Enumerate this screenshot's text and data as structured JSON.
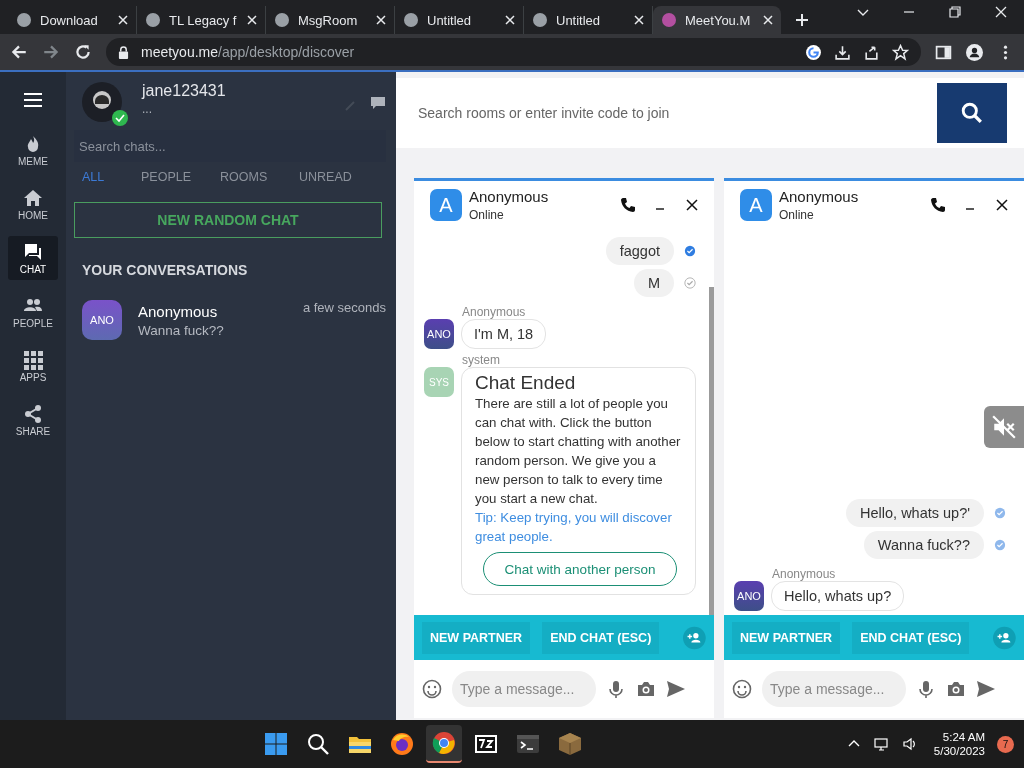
{
  "browser": {
    "tabs": [
      {
        "title": "Download",
        "selected": false
      },
      {
        "title": "TL Legacy f",
        "selected": false
      },
      {
        "title": "MsgRoom",
        "selected": false
      },
      {
        "title": "Untitled",
        "selected": false
      },
      {
        "title": "Untitled",
        "selected": false
      },
      {
        "title": "MeetYou.M",
        "selected": true
      }
    ],
    "address": {
      "domain": "meetyou.me",
      "path": "/app/desktop/discover"
    }
  },
  "nav": [
    {
      "label": "MEME",
      "selected": false
    },
    {
      "label": "HOME",
      "selected": false
    },
    {
      "label": "CHAT",
      "selected": true
    },
    {
      "label": "PEOPLE",
      "selected": false
    },
    {
      "label": "APPS",
      "selected": false
    },
    {
      "label": "SHARE",
      "selected": false
    }
  ],
  "profile": {
    "username": "jane123431",
    "status": "...",
    "online": true
  },
  "chat_search": {
    "placeholder": "Search chats..."
  },
  "filters": [
    {
      "label": "ALL",
      "selected": true
    },
    {
      "label": "PEOPLE",
      "selected": false
    },
    {
      "label": "ROOMS",
      "selected": false
    },
    {
      "label": "UNREAD",
      "selected": false
    }
  ],
  "new_chat_button": "NEW RANDOM CHAT",
  "conversations_heading": "YOUR CONVERSATIONS",
  "conversations": [
    {
      "avatar": "ANO",
      "name": "Anonymous",
      "preview": "Wanna fuck??",
      "time": "a few seconds"
    }
  ],
  "room_search": {
    "placeholder": "Search rooms or enter invite code to join"
  },
  "chat_windows": [
    {
      "avatar": "A",
      "name": "Anonymous",
      "status": "Online",
      "sound_muted": false,
      "messages": [
        {
          "kind": "sent",
          "text": "faggot",
          "read": true
        },
        {
          "kind": "sent",
          "text": "M",
          "read": false
        },
        {
          "kind": "received",
          "sender": "Anonymous",
          "avatar": "ANO",
          "text": "I'm M, 18"
        },
        {
          "kind": "system",
          "sender": "system",
          "avatar": "SYS",
          "title": "Chat Ended",
          "body": "There are still a lot of people you can chat with. Click the button below to start chatting with another random person. We give you a new person to talk to every time you start a new chat.",
          "tip": "Tip: Keep trying, you will discover great people.",
          "button": "Chat with another person"
        }
      ],
      "actions": [
        "NEW PARTNER",
        "END CHAT (ESC)"
      ],
      "input": {
        "placeholder": "Type a message..."
      }
    },
    {
      "avatar": "A",
      "name": "Anonymous",
      "status": "Online",
      "sound_muted": true,
      "messages": [
        {
          "kind": "sent",
          "text": "Hello, whats up?'",
          "read": true
        },
        {
          "kind": "sent",
          "text": "Wanna fuck??",
          "read": true
        },
        {
          "kind": "received",
          "sender": "Anonymous",
          "avatar": "ANO",
          "text": "Hello, whats up?"
        }
      ],
      "actions": [
        "NEW PARTNER",
        "END CHAT (ESC)"
      ],
      "input": {
        "placeholder": "Type a message..."
      }
    }
  ],
  "taskbar": {
    "apps": [
      {
        "selected": false
      },
      {
        "selected": false
      },
      {
        "selected": false
      },
      {
        "selected": false
      },
      {
        "selected": true
      },
      {
        "selected": false
      },
      {
        "selected": false
      },
      {
        "selected": false
      }
    ],
    "time": "5:24 AM",
    "date": "5/30/2023",
    "notifications": "7"
  }
}
